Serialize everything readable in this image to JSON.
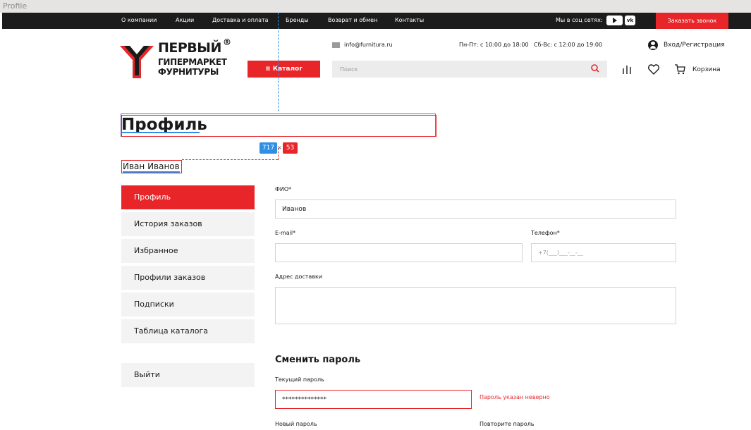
{
  "frame": {
    "label": "Profile"
  },
  "topbar": {
    "nav": [
      "О компании",
      "Акции",
      "Доставка и оплата",
      "Бренды",
      "Возврат и обмен",
      "Контакты"
    ],
    "social_label": "Мы в соц сетях:",
    "vk_label": "vk",
    "callback_label": "Заказать звонок"
  },
  "header": {
    "logo": {
      "line1": "ПЕРВЫЙ",
      "reg": "®",
      "line2": "ГИПЕРМАРКЕТ",
      "line3": "ФУРНИТУРЫ"
    },
    "email": "info@furnitura.ru",
    "hours_weekdays": "Пн-Пт: с 10:00 до 18:00",
    "hours_weekend": "Сб-Вс: с 12:00 до 19:00",
    "login_label": "Вход/Регистрация",
    "catalog_label": "≡ Каталог",
    "search_placeholder": "Поиск",
    "cart_label": "Корзина"
  },
  "overlay": {
    "width": "717",
    "times": "×",
    "height": "53"
  },
  "page": {
    "title": "Профиль",
    "user_name": "Иван Иванов"
  },
  "sidebar": {
    "items": [
      "Профиль",
      "История заказов",
      "Избранное",
      "Профили заказов",
      "Подписки",
      "Таблица каталога"
    ],
    "logout": "Выйти"
  },
  "form": {
    "fio_label": "ФИО*",
    "fio_value": "Иванов",
    "email_label": "E-mail*",
    "phone_label": "Телефон*",
    "phone_placeholder": "+7(___)___-__-__",
    "address_label": "Адрес доставки",
    "change_password_title": "Сменить пароль",
    "current_password_label": "Текущий пароль",
    "current_password_value": "**************",
    "password_error": "Пароль указан неверно",
    "new_password_label": "Новый пароль",
    "repeat_password_label": "Повторите пароль"
  },
  "colors": {
    "accent": "#e8262a",
    "topbar": "#1c1c1c",
    "guide_blue": "#2f8fe4",
    "field_bg": "#ececec"
  }
}
